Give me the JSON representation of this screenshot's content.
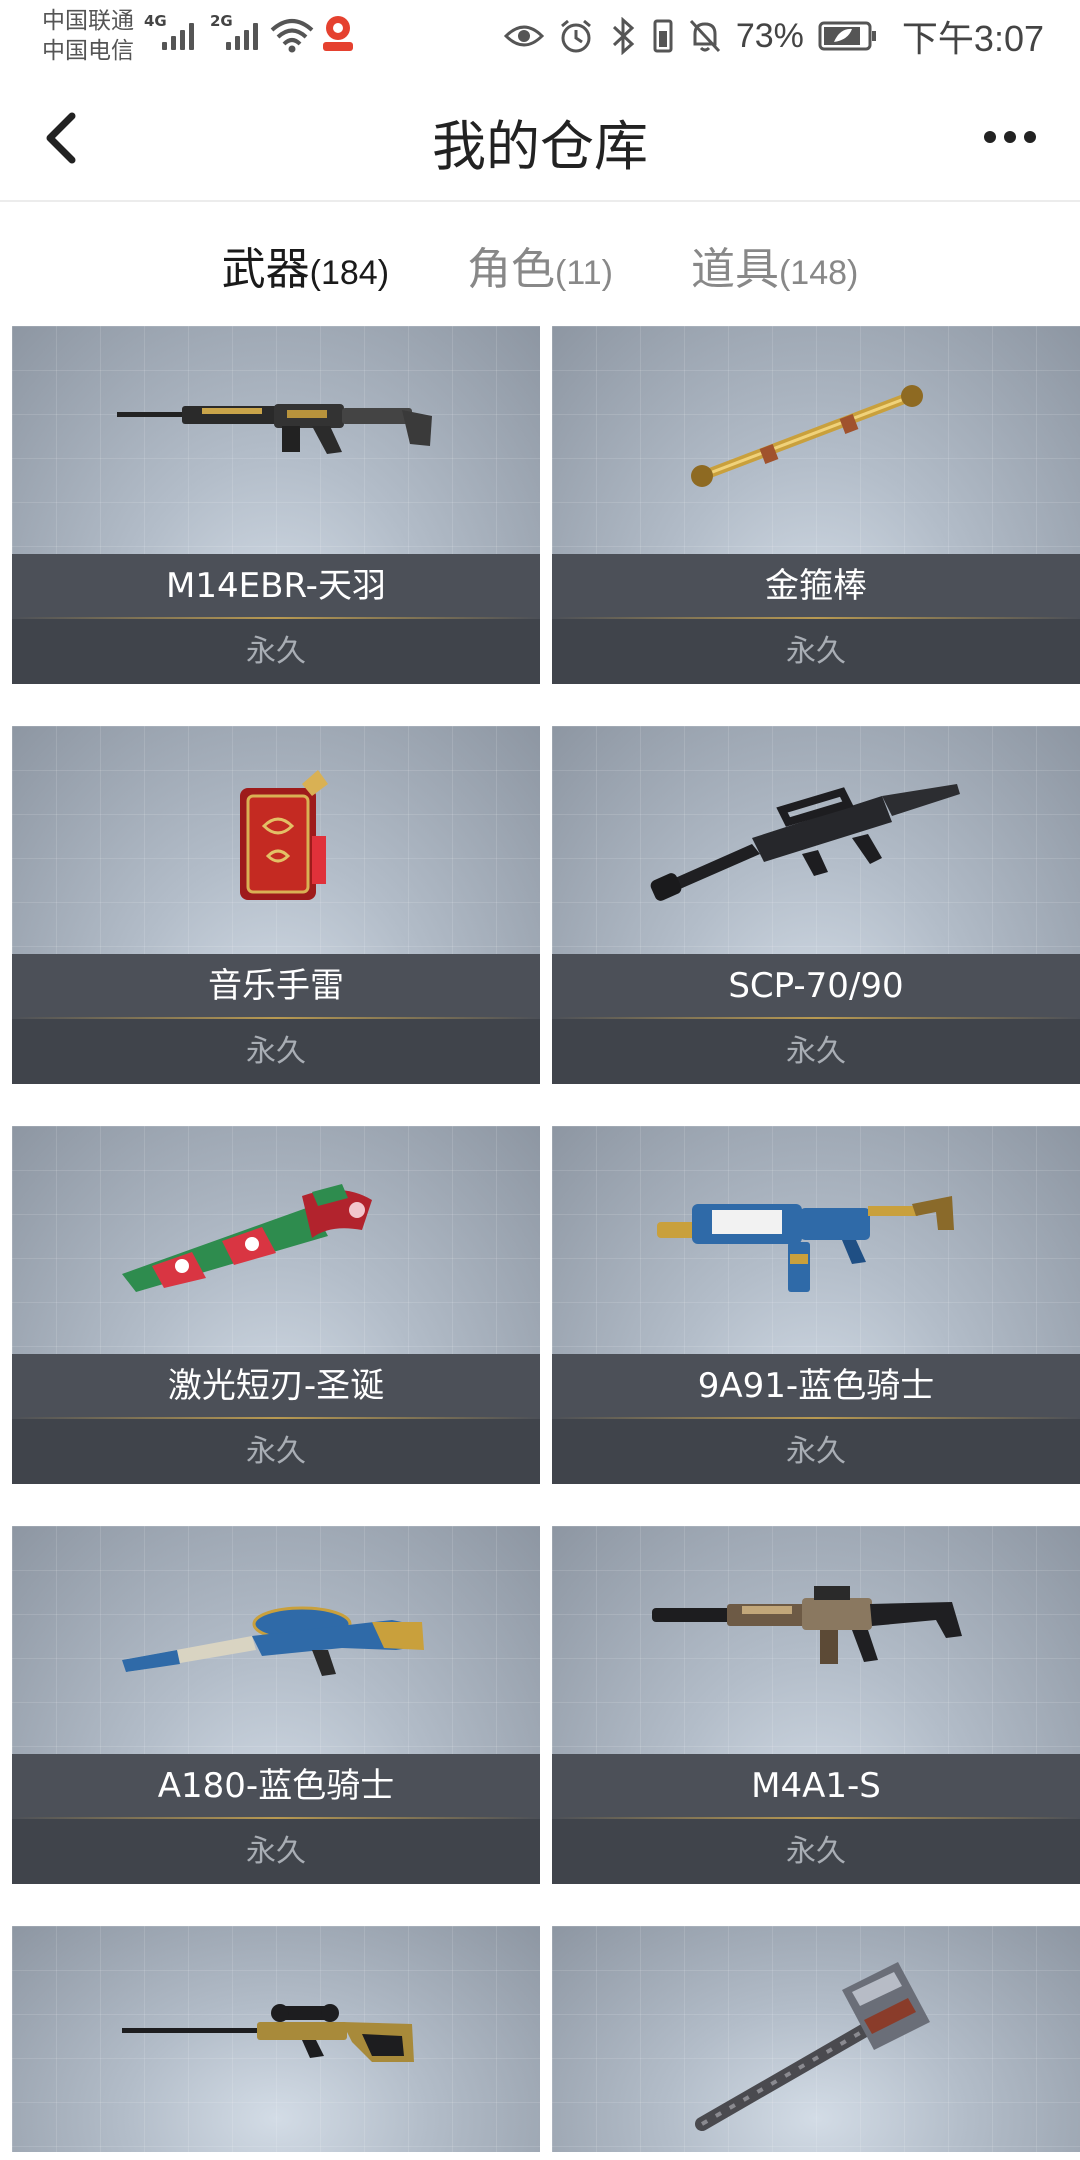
{
  "status_bar": {
    "carrier1": "中国联通",
    "carrier2": "中国电信",
    "net1": "4G",
    "net2": "2G",
    "battery_percent": "73%",
    "time": "下午3:07"
  },
  "nav": {
    "title": "我的仓库"
  },
  "tabs": [
    {
      "label": "武器",
      "count": "(184)",
      "active": true
    },
    {
      "label": "角色",
      "count": "(11)",
      "active": false
    },
    {
      "label": "道具",
      "count": "(148)",
      "active": false
    }
  ],
  "items": [
    {
      "name": "M14EBR-天羽",
      "duration": "永久",
      "icon": "rifle-icon"
    },
    {
      "name": "金箍棒",
      "duration": "永久",
      "icon": "staff-icon"
    },
    {
      "name": "音乐手雷",
      "duration": "永久",
      "icon": "red-canister-icon"
    },
    {
      "name": "SCP-70/90",
      "duration": "永久",
      "icon": "rifle-icon"
    },
    {
      "name": "激光短刃-圣诞",
      "duration": "永久",
      "icon": "blade-icon"
    },
    {
      "name": "9A91-蓝色骑士",
      "duration": "永久",
      "icon": "rifle-icon"
    },
    {
      "name": "A180-蓝色骑士",
      "duration": "永久",
      "icon": "drum-rifle-icon"
    },
    {
      "name": "M4A1-S",
      "duration": "永久",
      "icon": "rifle-icon"
    },
    {
      "name": "",
      "duration": "",
      "icon": "sniper-rifle-icon"
    },
    {
      "name": "",
      "duration": "",
      "icon": "hammer-icon"
    }
  ],
  "colors": {
    "card_name_bg": "#4c5058",
    "card_duration_bg": "#40444b",
    "gold_separator": "#b89a52"
  }
}
